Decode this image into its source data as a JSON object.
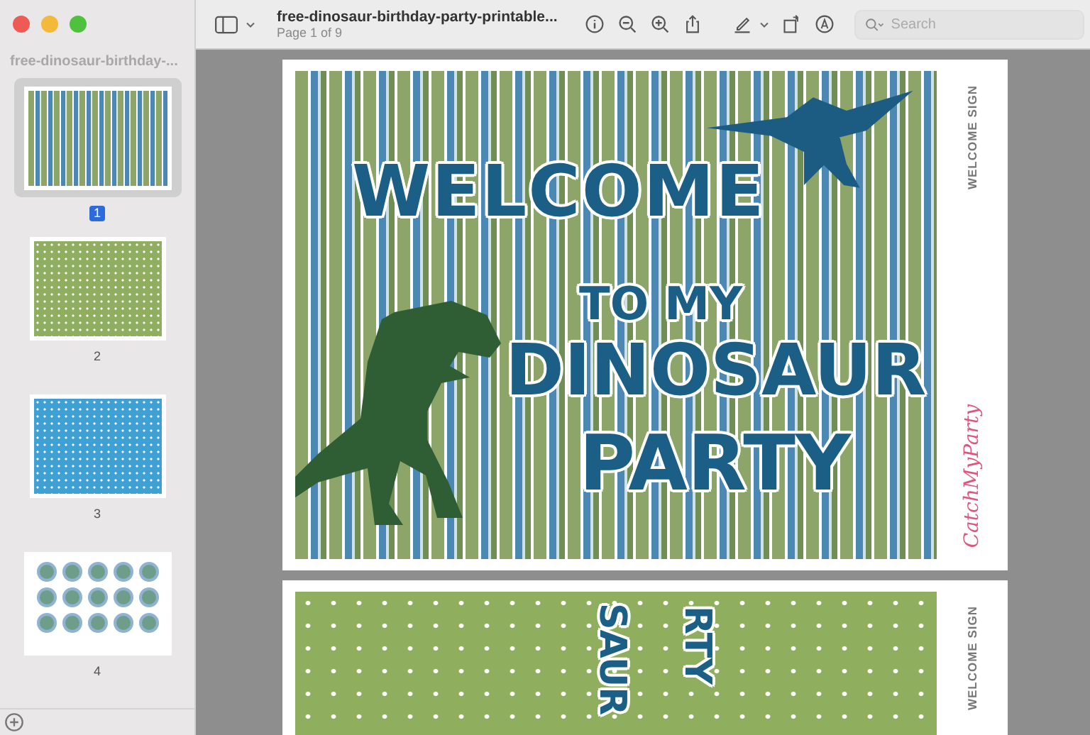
{
  "sidebar": {
    "title": "free-dinosaur-birthday-...",
    "thumbnails": [
      {
        "kind": "stripes",
        "page_number": "1",
        "selected": true
      },
      {
        "kind": "green-dots",
        "page_number": "2",
        "selected": false
      },
      {
        "kind": "blue-dots",
        "page_number": "3",
        "selected": false
      },
      {
        "kind": "stickers",
        "page_number": "4",
        "selected": false
      }
    ]
  },
  "toolbar": {
    "document_title": "free-dinosaur-birthday-party-printable...",
    "page_info": "Page 1 of 9",
    "search": {
      "placeholder": "Search"
    }
  },
  "pages": [
    {
      "kind": "stripes",
      "heading_lines": [
        "WELCOME",
        "TO MY",
        "DINOSAUR",
        "PARTY"
      ],
      "side_label": "WELCOME SIGN",
      "brand": "CatchMyParty"
    },
    {
      "kind": "green-dots",
      "heading_lines": [
        "SAUR",
        "RTY"
      ],
      "side_label": "WELCOME SIGN"
    }
  ]
}
